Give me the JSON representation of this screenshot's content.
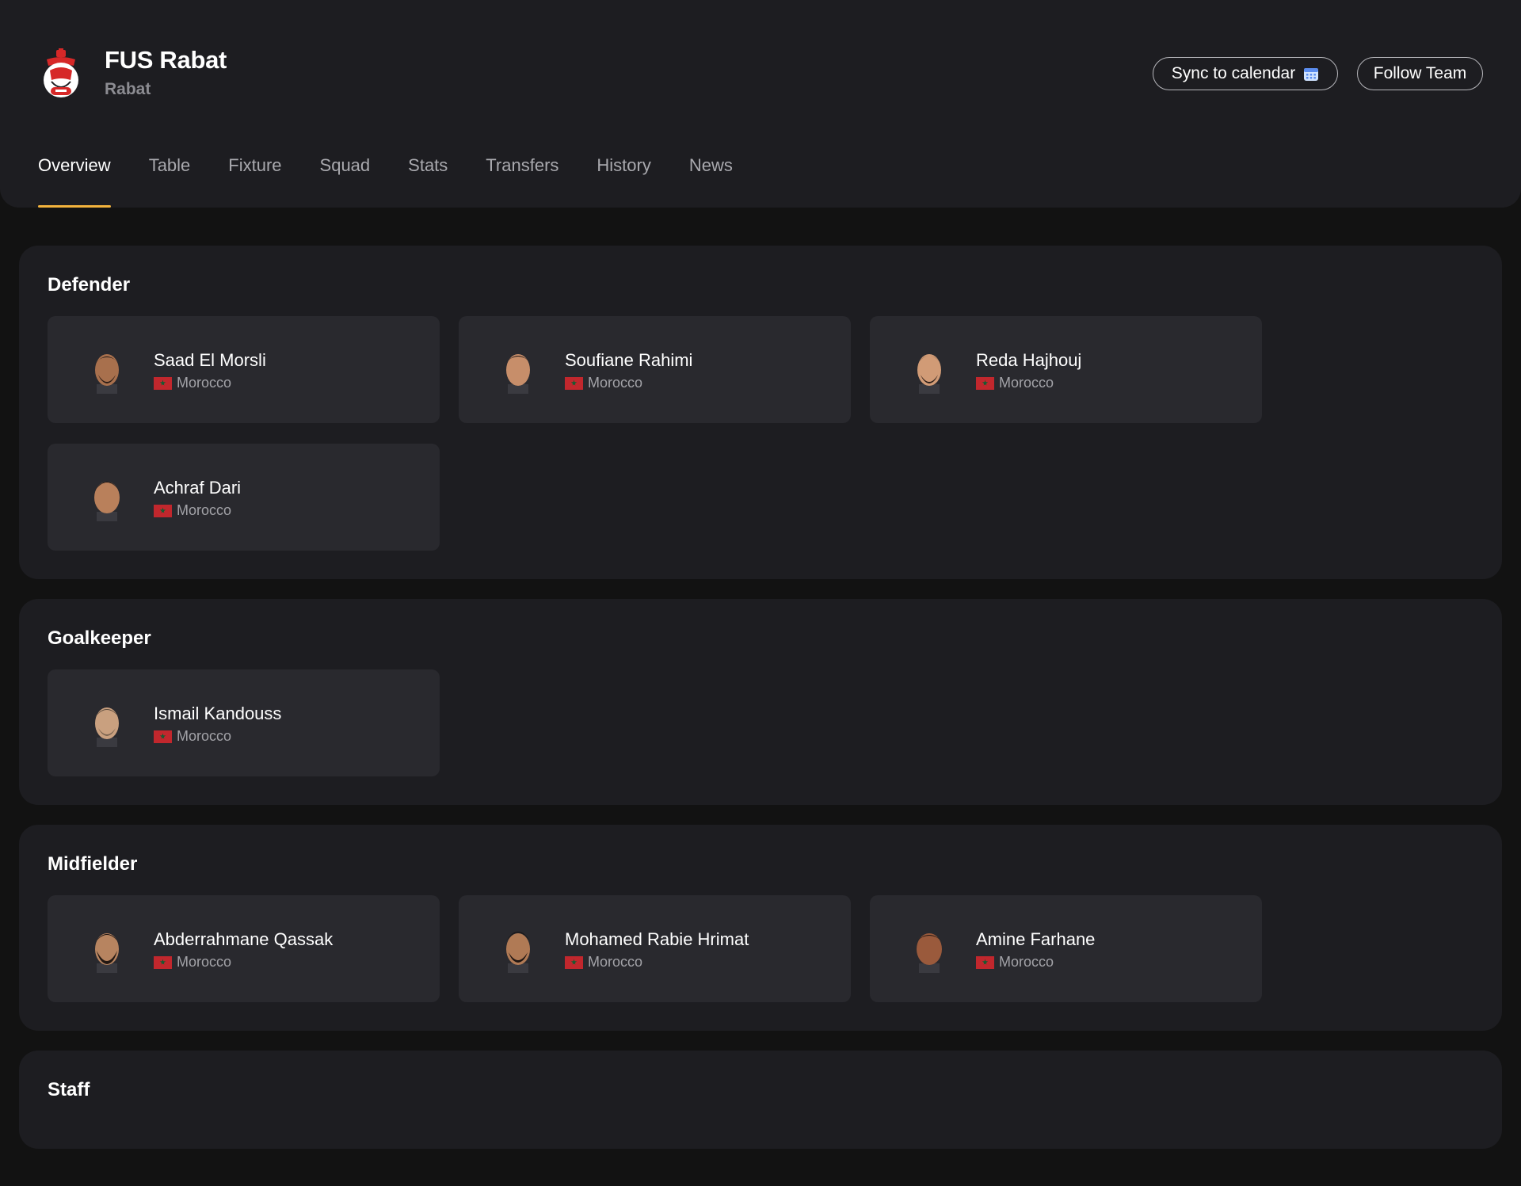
{
  "team": {
    "name": "FUS Rabat",
    "city": "Rabat"
  },
  "actions": {
    "sync_label": "Sync to calendar",
    "follow_label": "Follow Team"
  },
  "tabs": [
    "Overview",
    "Table",
    "Fixture",
    "Squad",
    "Stats",
    "Transfers",
    "History",
    "News"
  ],
  "active_tab": "Overview",
  "colors": {
    "background": "#121212",
    "panel": "#1d1d21",
    "card": "#29292e",
    "accent": "#f3b33d",
    "flag": "#c1272d"
  },
  "squad": [
    {
      "position": "Defender",
      "players": [
        {
          "name": "Saad El Morsli",
          "nation": "Morocco"
        },
        {
          "name": "Soufiane Rahimi",
          "nation": "Morocco"
        },
        {
          "name": "Reda Hajhouj",
          "nation": "Morocco"
        },
        {
          "name": "Achraf Dari",
          "nation": "Morocco"
        }
      ]
    },
    {
      "position": "Goalkeeper",
      "players": [
        {
          "name": "Ismail Kandouss",
          "nation": "Morocco"
        }
      ]
    },
    {
      "position": "Midfielder",
      "players": [
        {
          "name": "Abderrahmane Qassak",
          "nation": "Morocco"
        },
        {
          "name": "Mohamed Rabie Hrimat",
          "nation": "Morocco"
        },
        {
          "name": "Amine Farhane",
          "nation": "Morocco"
        }
      ]
    },
    {
      "position": "Staff",
      "players": []
    }
  ]
}
